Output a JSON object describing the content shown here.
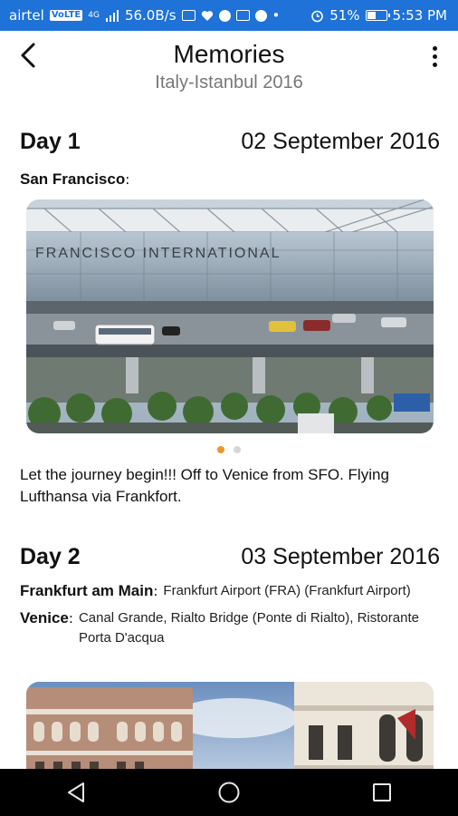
{
  "status_bar": {
    "carrier": "airtel",
    "network_badge": "VoLTE",
    "signal": "4G",
    "speed": "56.0B/s",
    "battery_percent": "51%",
    "battery_level": 0.51,
    "time": "5:53 PM"
  },
  "header": {
    "title": "Memories",
    "subtitle": "Italy-Istanbul 2016",
    "back_icon": "chevron-left-icon",
    "menu_icon": "more-vertical-icon"
  },
  "days": [
    {
      "label": "Day 1",
      "date": "02 September 2016",
      "places": [
        {
          "name": "San Francisco",
          "desc": ""
        }
      ],
      "photo": {
        "caption_text": "FRANCISCO INTERNATIONAL",
        "current": 1,
        "total": 2
      },
      "note": "Let the journey begin!!! Off to Venice from SFO. Flying Lufthansa via Frankfort."
    },
    {
      "label": "Day 2",
      "date": "03 September 2016",
      "places": [
        {
          "name": "Frankfurt am Main",
          "desc": "Frankfurt Airport (FRA) (Frankfurt Airport)"
        },
        {
          "name": "Venice",
          "desc": "Canal Grande, Rialto Bridge (Ponte di Rialto), Ristorante Porta D'acqua"
        }
      ]
    }
  ],
  "nav": {
    "back": "triangle-back-icon",
    "home": "circle-home-icon",
    "recents": "square-recents-icon"
  },
  "colors": {
    "status_bar": "#1e72d8",
    "dot_active": "#f0962a",
    "dot_inactive": "#d6d6d6"
  }
}
